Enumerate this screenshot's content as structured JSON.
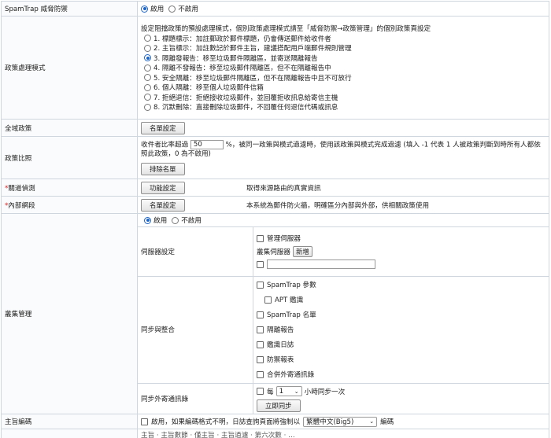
{
  "spamtrap": {
    "label": "SpamTrap 威脅防禦",
    "enabled": "啟用",
    "disabled": "不啟用"
  },
  "policy_mode": {
    "label": "政策處理模式",
    "description": "設定阻擋政策的預設處理模式，個別政策處理模式請至「威脅防禦→政策管理」的個別政策頁設定",
    "options": [
      "1. 標題標示：加註郵政於郵件標題，仍會傳送郵件給收件者",
      "2. 主旨標示：加註數記於郵件主旨，建議搭配用戶端郵件規則管理",
      "3. 隔離發報告：移至垃圾郵件隔離區，並寄送隔離報告",
      "4. 隔離不發報告：移至垃圾郵件隔離區，但不在隔離報告中",
      "5. 安全隔離：移至垃圾郵件隔離區，但不在隔離報告中且不可放行",
      "6. 個人隔離：移至個人垃圾郵件信箱",
      "7. 拒絕退信：拒絕接收垃圾郵件，並回覆拒收訊息給寄信主機",
      "8. 沉默刪除：直接刪除垃圾郵件，不回覆任何退信代碼或訊息"
    ]
  },
  "global_policy": {
    "label": "全域政策",
    "button": "名單設定"
  },
  "policy_ratio": {
    "label": "政策比照",
    "prefix": "收件者比率超過",
    "value": "50",
    "text": "%，被同一政策與模式過濾時，使用該政策與模式完成過濾 (填入 -1 代表 1 人被政策判斷到時所有人都依照此政策，0 為不啟用)",
    "button": "排除名單"
  },
  "relay_detect": {
    "label": "關道偵測",
    "button": "功能設定",
    "desc": "取得來源路由的真實資訊"
  },
  "internal_net": {
    "label": "內部網段",
    "button": "名單設定",
    "desc": "本系統為郵件防火牆，明確區分內部與外部，供相關政策使用"
  },
  "cluster": {
    "label": "叢集管理",
    "enabled": "啟用",
    "disabled": "不啟用",
    "server_settings": {
      "label": "伺服器設定",
      "manage_server": "管理伺服器",
      "cluster_server": "叢集伺服器",
      "add_button": "新增"
    },
    "sync": {
      "label": "同步與整合",
      "items": [
        "SpamTrap 參數",
        "APT 鑑識",
        "SpamTrap 名單",
        "隔離報告",
        "鑑識日誌",
        "防禦報表",
        "合併外寄通訊錄"
      ]
    },
    "sync_out": {
      "label": "同步外寄通訊錄",
      "every": "每",
      "interval": "1",
      "unit": "小時同步一次",
      "sync_now": "立即同步"
    }
  },
  "subject_encoding": {
    "label": "主旨編碼",
    "enable_text": "啟用，如果編碼格式不明，日誌查詢頁面將強制以",
    "encoding": "繁體中文(Big5)",
    "suffix": "編碼"
  },
  "footer_partial": "主旨  ·  主旨數節  ·  僅主旨  ·  主旨過濾  ·  第六次數  ·  …"
}
